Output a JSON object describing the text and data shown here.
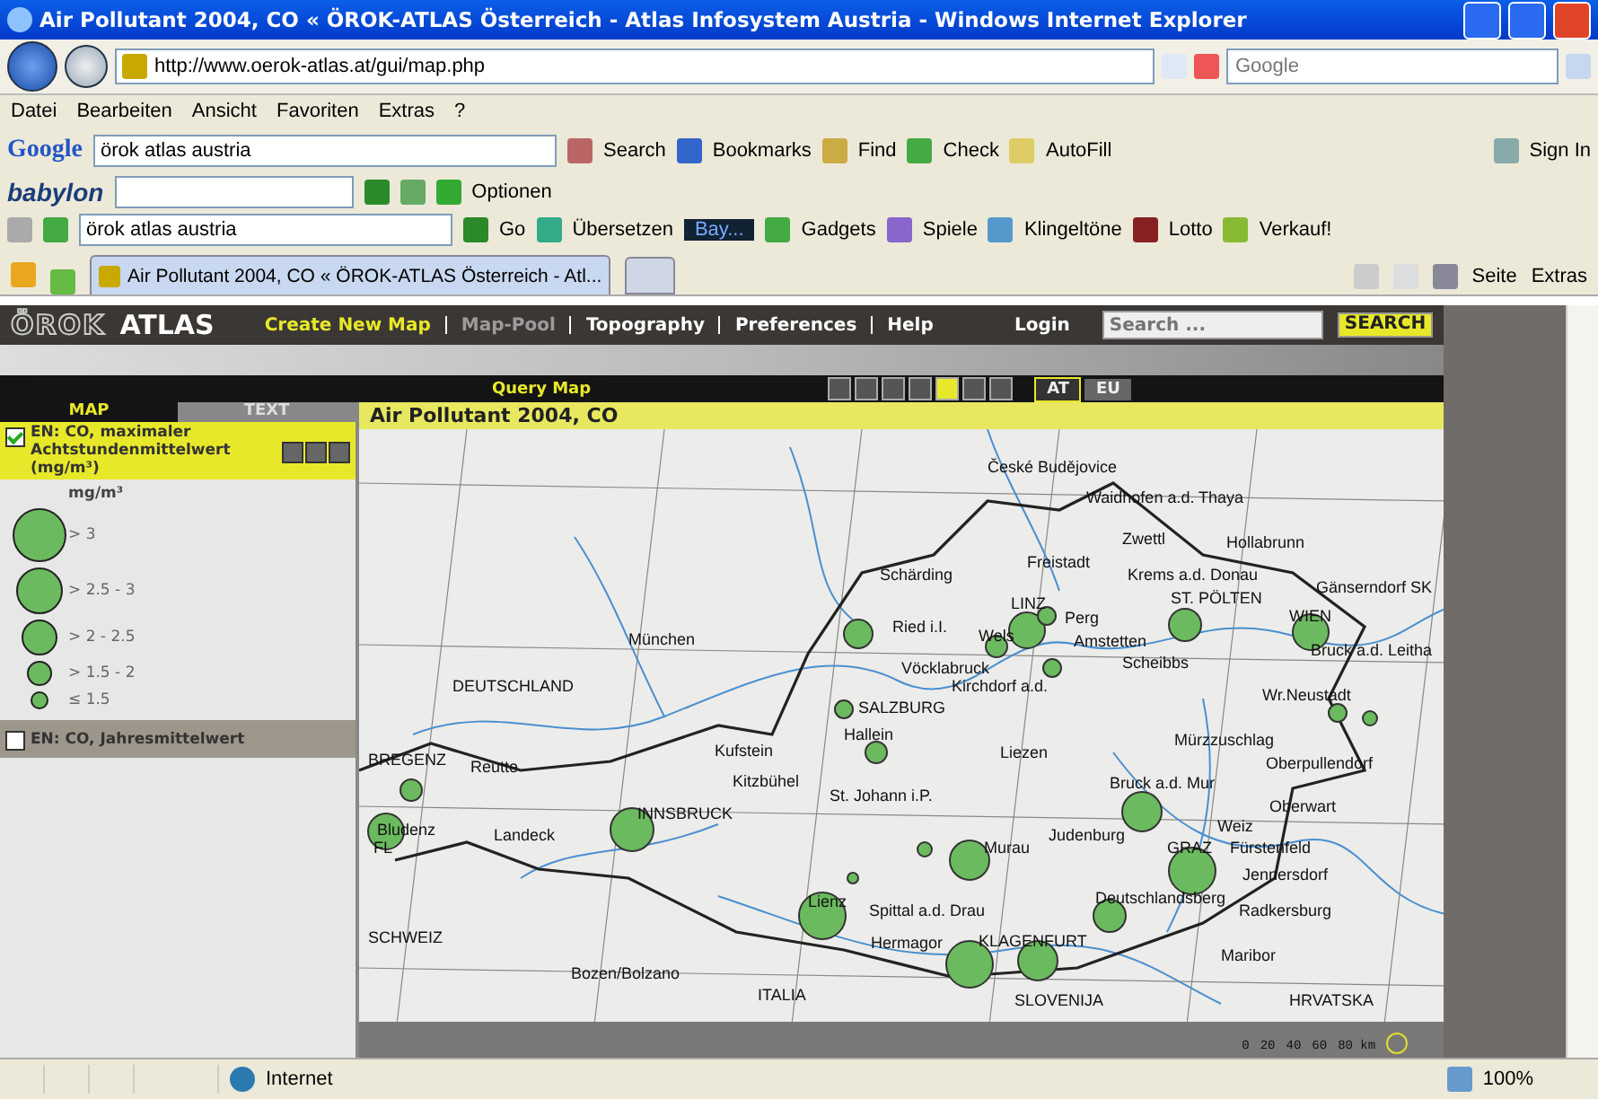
{
  "window": {
    "title": "Air Pollutant 2004, CO « ÖROK-ATLAS Österreich - Atlas Infosystem Austria - Windows Internet Explorer"
  },
  "address_bar": {
    "url": "http://www.oerok-atlas.at/gui/map.php",
    "search_placeholder": "Google"
  },
  "menu": [
    "Datei",
    "Bearbeiten",
    "Ansicht",
    "Favoriten",
    "Extras",
    "?"
  ],
  "google_toolbar": {
    "logo": "Google",
    "query": "örok atlas austria",
    "items": [
      "Search",
      "Bookmarks",
      "Find",
      "Check",
      "AutoFill",
      "Sign In"
    ]
  },
  "babylon_toolbar": {
    "logo": "babylon",
    "button": "Optionen"
  },
  "search_toolbar": {
    "query": "örok atlas austria",
    "go": "Go",
    "translate": "Übersetzen",
    "radio": "Bay...",
    "items": [
      "Gadgets",
      "Spiele",
      "Klingeltöne",
      "Lotto",
      "Verkauf!"
    ]
  },
  "tabs": [
    {
      "label": "Air Pollutant 2004, CO « ÖROK-ATLAS Österreich - Atl...",
      "selected": true
    }
  ],
  "command_bar": [
    "Seite",
    "Extras"
  ],
  "atlas": {
    "logo_outline": "ÖROK",
    "logo_bold": "ATLAS",
    "nav": [
      {
        "label": "Create New Map",
        "selected": true,
        "disabled": false
      },
      {
        "label": "Map-Pool",
        "selected": false,
        "disabled": true
      },
      {
        "label": "Topography",
        "selected": false,
        "disabled": false
      },
      {
        "label": "Preferences",
        "selected": false,
        "disabled": false
      },
      {
        "label": "Help",
        "selected": false,
        "disabled": false
      }
    ],
    "login": "Login",
    "search_placeholder": "Search ...",
    "search_button": "SEARCH",
    "query_map": "Query Map",
    "regions": [
      {
        "label": "AT",
        "selected": true
      },
      {
        "label": "EU",
        "selected": false
      }
    ]
  },
  "panel_tabs": [
    {
      "label": "MAP",
      "selected": true
    },
    {
      "label": "TEXT",
      "selected": false
    }
  ],
  "layers": [
    {
      "title": "EN: CO, maximaler Achtstundenmittelwert (mg/m³)",
      "checked": true,
      "unit": "mg/m³",
      "legend": [
        "> 3",
        "> 2.5 - 3",
        "> 2 - 2.5",
        "> 1.5 - 2",
        "≤ 1.5"
      ]
    },
    {
      "title": "EN: CO, Jahresmittelwert",
      "checked": false
    }
  ],
  "map": {
    "title": "Air Pollutant 2004, CO",
    "places": [
      "České Budějovice",
      "Waidhofen a.d. Thaya",
      "Zwettl",
      "Hollabrunn",
      "Freistadt",
      "Schärding",
      "Krems a.d. Donau",
      "Gänserndorf SK",
      "LINZ",
      "Perg",
      "ST. PÖLTEN",
      "WIEN",
      "Ried i.I.",
      "Wels",
      "Amstetten",
      "Bruck a.d. Leitha",
      "München",
      "Scheibbs",
      "Vöcklabruck",
      "Kirchdorf a.d.",
      "DEUTSCHLAND",
      "Wr.Neustadt",
      "SALZBURG",
      "Hallein",
      "Mürzzuschlag",
      "Kufstein",
      "Liezen",
      "BREGENZ",
      "Reutte",
      "Oberpullendorf",
      "Kitzbühel",
      "INNSBRUCK",
      "St. Johann i.P.",
      "Bruck a.d. Mur",
      "Bludenz",
      "Landeck",
      "Oberwart",
      "Weiz",
      "FL",
      "Judenburg",
      "Murau",
      "GRAZ",
      "Fürstenfeld",
      "Jennersdorf",
      "Lienz",
      "Spittal a.d. Drau",
      "Deutschlandsberg",
      "Radkersburg",
      "SCHWEIZ",
      "Hermagor",
      "KLAGENFURT",
      "Maribor",
      "Bozen/Bolzano",
      "ITALIA",
      "SLOVENIJA",
      "HRVATSKA"
    ],
    "scale_labels": [
      "0",
      "20",
      "40",
      "60",
      "80 km"
    ]
  },
  "status_bar": {
    "zone": "Internet",
    "zoom": "100%"
  }
}
